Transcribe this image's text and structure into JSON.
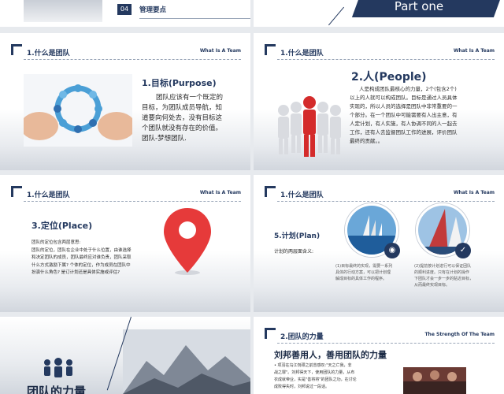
{
  "slide1": {
    "number": "04",
    "label": "管理要点"
  },
  "slide2": {
    "label": "Part one"
  },
  "slide3": {
    "section": "1.什么是团队",
    "section_en": "What Is A Team",
    "heading": "1.目标(Purpose)",
    "lines": [
      "团队应该有一个既定的",
      "目标，为团队成员导航，知",
      "道要向何处去，没有目标这",
      "个团队就没有存在的价值。",
      "团队-梦想团队."
    ]
  },
  "slide4": {
    "section": "1.什么是团队",
    "section_en": "What Is A Team",
    "heading": "2.人(People)",
    "lines": [
      "人是构成团队最核心的力量，2个(包含2个)",
      "以上的人就可以构成团队。目标是通过人员具体",
      "实现的，所以人员的选择是团队中非常重要的一",
      "个部分。在一个团队中可能需要有人出主意，有",
      "人定计划，有人实施，有人协调不同的人一起去",
      "工作，还有人去监督团队工作的进展，评价团队",
      "最终的贡献。。"
    ]
  },
  "slide5": {
    "section": "1.什么是团队",
    "section_en": "What Is A Team",
    "heading": "3.定位(Place)",
    "lines": [
      "团队的定位包含两层意思:",
      "团队的定位，团队在企业中处于什么位置，由谁选择",
      "和决定团队的成员，团队最终应对谁负责，团队采取",
      "什么方式激励下属? 个体的定位，作为成员在团队中",
      "扮演什么角色? 是订计划还是具体实施或评估?"
    ]
  },
  "slide6": {
    "section": "1.什么是团队",
    "section_en": "What Is A Team",
    "heading": "5.计划(Plan)",
    "intro": "计划的两层面含义:",
    "left_lines": [
      "(1)目标最终的实现，需要一系列",
      "具体的行动方案，可以把计划理",
      "解成目标的具体工作的程序。"
    ],
    "right_lines": [
      "(2)提前按计划进行可以保证团队",
      "的顺利进度。只有在计划的操作",
      "下团队才会一步一步的贴近目标，",
      "从而最终实现目标。"
    ]
  },
  "slide7": {
    "title": "团队的力量"
  },
  "slide8": {
    "section": "2.团队的力量",
    "section_en": "The Strength Of The Team",
    "heading": "刘邦善用人，善用团队的力量",
    "lines": [
      "• 项羽在乌江刎颈之前曾感叹:\"天之亡我，非",
      "战之罪\"。刘邦得天下，使用团队的力量，从布",
      "衣成就帝业，实是\"善将将\"的团队之功，在讨论",
      "成败得失时，刘邦说过一段话。"
    ]
  }
}
